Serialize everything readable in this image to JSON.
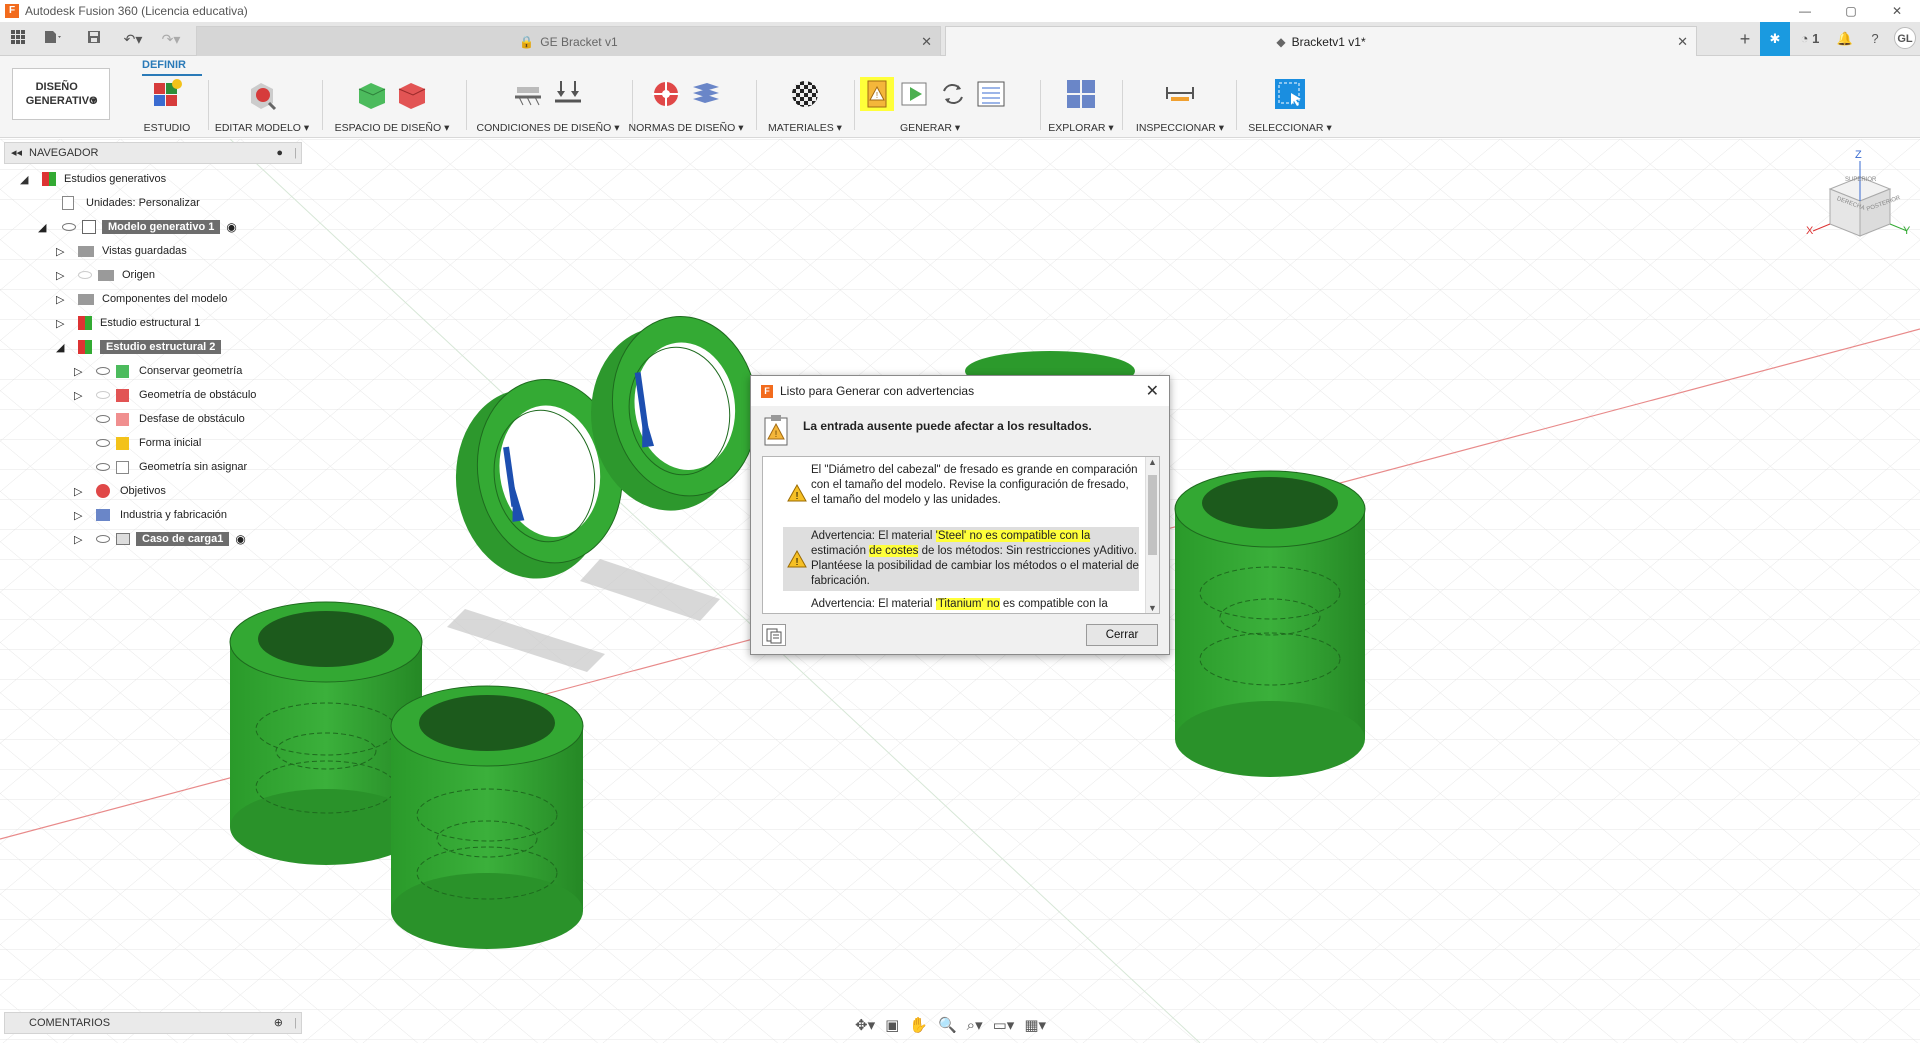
{
  "window": {
    "title": "Autodesk Fusion 360 (Licencia educativa)",
    "controls": [
      "—",
      "▢",
      "✕"
    ]
  },
  "tabs": {
    "doc1": "GE Bracket v1",
    "doc2": "Bracketv1 v1*",
    "close": "✕",
    "plus": "+",
    "job_count": "1",
    "user": "GL"
  },
  "ribbon": {
    "active_tab": "DEFINIR",
    "workspace": "DISEÑO GENERATIVO",
    "groups": [
      "ESTUDIO",
      "EDITAR MODELO",
      "ESPACIO DE DISEÑO",
      "CONDICIONES DE DISEÑO",
      "NORMAS DE DISEÑO",
      "MATERIALES",
      "GENERAR",
      "EXPLORAR",
      "INSPECCIONAR",
      "SELECCIONAR"
    ]
  },
  "browser": {
    "title": "NAVEGADOR",
    "items": [
      {
        "label": "Estudios generativos"
      },
      {
        "label": "Unidades: Personalizar"
      },
      {
        "label": "Modelo generativo 1"
      },
      {
        "label": "Vistas guardadas"
      },
      {
        "label": "Origen"
      },
      {
        "label": "Componentes del modelo"
      },
      {
        "label": "Estudio estructural 1"
      },
      {
        "label": "Estudio estructural 2"
      },
      {
        "label": "Conservar geometría"
      },
      {
        "label": "Geometría de obstáculo"
      },
      {
        "label": "Desfase de obstáculo"
      },
      {
        "label": "Forma inicial"
      },
      {
        "label": "Geometría sin asignar"
      },
      {
        "label": "Objetivos"
      },
      {
        "label": "Industria y fabricación"
      },
      {
        "label": "Caso de carga1"
      }
    ]
  },
  "viewcube": {
    "top": "SUPERIOR",
    "front": "DERECHA",
    "right": "POSTERIOR",
    "z": "Z",
    "x": "X",
    "y": "Y"
  },
  "dialog": {
    "title": "Listo para Generar con advertencias",
    "heading": "La entrada ausente puede afectar a los resultados.",
    "msg1": "El \"Diámetro del cabezal\" de fresado es grande en comparación con el tamaño del modelo. Revise la configuración de fresado, el tamaño del modelo y las unidades.",
    "msg2_a": "Advertencia: El material ",
    "msg2_b": "'Steel' no es compatible con la",
    "msg2_c": " estimación ",
    "msg2_d": "de costes",
    "msg2_e": " de los métodos: Sin restricciones yAditivo. Plantéese la posibilidad de cambiar los métodos o el material de fabricación.",
    "msg3_a": "Advertencia: El material ",
    "msg3_b": "'Titanium' no",
    "msg3_c": " es compatible con la",
    "close_button": "Cerrar"
  },
  "comments": {
    "title": "COMENTARIOS"
  },
  "colors": {
    "accent": "#2a7ab8",
    "part_green": "#2e9e2e",
    "load_blue": "#1d4fb0",
    "highlight": "#ffff3a"
  }
}
